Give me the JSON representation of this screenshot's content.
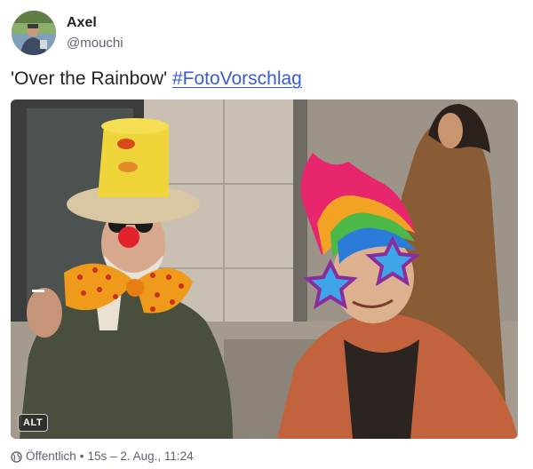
{
  "post": {
    "author": {
      "display_name": "Axel",
      "handle": "@mouchi",
      "avatar_icon": "avatar-photo"
    },
    "content": {
      "text": "'Over the Rainbow' ",
      "hashtag": "#FotoVorschlag"
    },
    "media": {
      "alt_badge": "ALT"
    },
    "footer": {
      "visibility_icon": "globe-icon",
      "visibility": "Öffentlich",
      "separator": "•",
      "relative_time": "15s",
      "absolute_time": "2. Aug., 11:24"
    },
    "colors": {
      "link": "#3a5bd8",
      "muted": "#5c6370",
      "text": "#1f2328"
    }
  }
}
